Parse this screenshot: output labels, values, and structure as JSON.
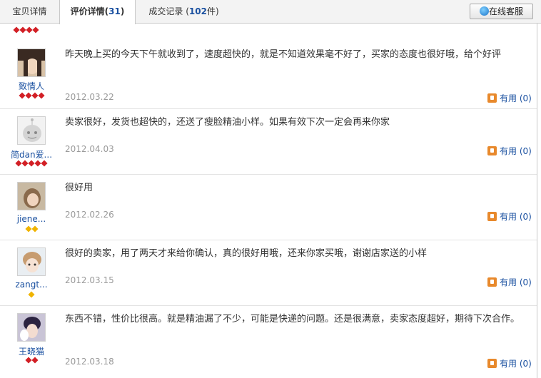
{
  "tabs": [
    {
      "label": "宝贝详情",
      "count": "",
      "suffix": "",
      "active": false
    },
    {
      "label": "评价详情(",
      "count": "31",
      "suffix": ")",
      "active": true
    },
    {
      "label": "成交记录 (",
      "count": "102",
      "suffix": "件)",
      "active": false
    }
  ],
  "online_service": {
    "label": "在线客服",
    "icon": "online-chat-icon"
  },
  "reviews": [
    {
      "user": "致情人",
      "rank": "red-4",
      "content": "昨天晚上买的今天下午就收到了，速度超快的，就是不知道效果毫不好了，买家的态度也很好哦，给个好评",
      "date": "2012.03.22",
      "useful_label": "有用",
      "useful_count": "(0)"
    },
    {
      "user": "简dan爱...",
      "rank": "red-5",
      "content": "卖家很好，发货也超快的，还送了瘦脸精油小样。如果有效下次一定会再来你家",
      "date": "2012.04.03",
      "useful_label": "有用",
      "useful_count": "(0)"
    },
    {
      "user": "jiene...",
      "rank": "yellow-2",
      "content": "很好用",
      "date": "2012.02.26",
      "useful_label": "有用",
      "useful_count": "(0)"
    },
    {
      "user": "zangt...",
      "rank": "yellow-1",
      "content": "很好的卖家，用了两天才来给你确认，真的很好用哦，还来你家买哦，谢谢店家送的小样",
      "date": "2012.03.15",
      "useful_label": "有用",
      "useful_count": "(0)"
    },
    {
      "user": "王晓猫",
      "rank": "red-2",
      "content": "东西不错，性价比很高。就是精油漏了不少，可能是快递的问题。还是很满意，卖家态度超好，期待下次合作。",
      "date": "2012.03.18",
      "useful_label": "有用",
      "useful_count": "(0)"
    }
  ],
  "colors": {
    "link": "#1a50a0",
    "date": "#9a9a9a",
    "gem_red": "#d21f25",
    "gem_yellow": "#f0b400",
    "useful_icon": "#e8892c"
  }
}
